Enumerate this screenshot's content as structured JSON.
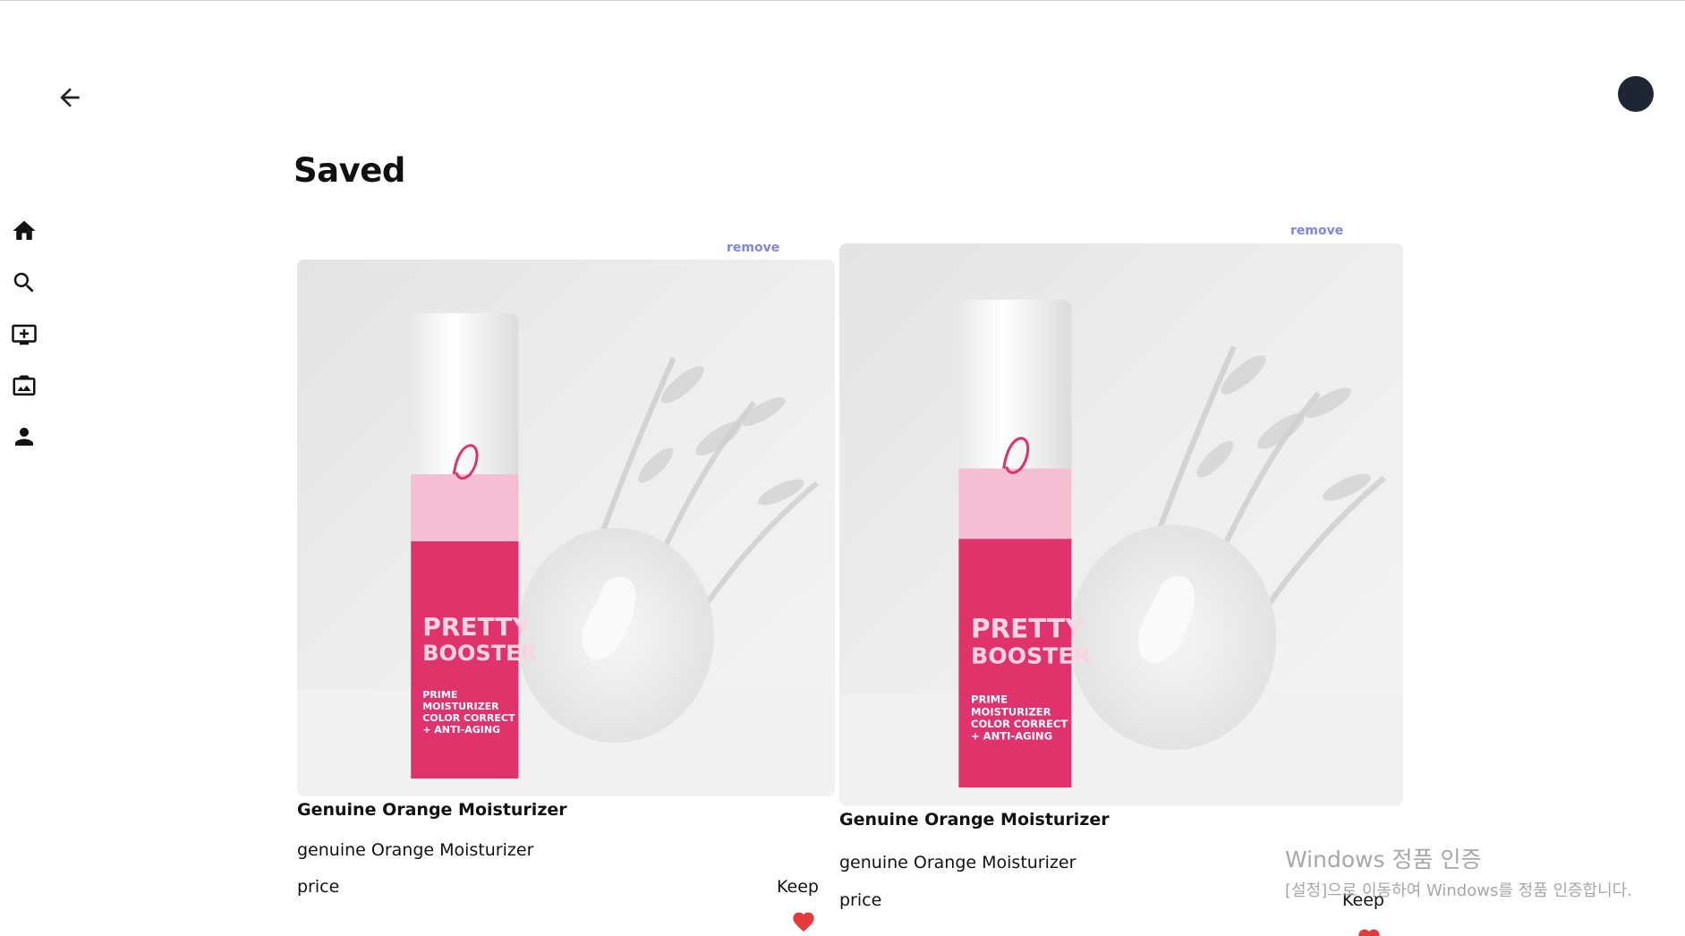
{
  "header": {
    "back_icon": "arrow-left-icon",
    "avatar_color": "#1e2533"
  },
  "sidebar": {
    "items": [
      {
        "icon": "home-icon"
      },
      {
        "icon": "search-icon"
      },
      {
        "icon": "add-post-icon"
      },
      {
        "icon": "gallery-icon"
      },
      {
        "icon": "profile-icon"
      }
    ]
  },
  "main": {
    "title": "Saved",
    "cards": [
      {
        "remove_label": "remove",
        "name": "Genuine Orange Moisturizer",
        "description": "genuine Orange Moisturizer",
        "price_label": "price",
        "keep_label": "Keep"
      },
      {
        "remove_label": "remove",
        "name": "Genuine Orange Moisturizer",
        "description": "genuine Orange Moisturizer",
        "price_label": "price",
        "keep_label": "Keep"
      }
    ]
  },
  "watermark": {
    "title": "Windows 정품 인증",
    "subtitle": "[설정]으로 이동하여 Windows를 정품 인증합니다."
  },
  "colors": {
    "remove_link": "#7f86e0",
    "heart": "#e53a3a",
    "avatar": "#1e2533"
  }
}
